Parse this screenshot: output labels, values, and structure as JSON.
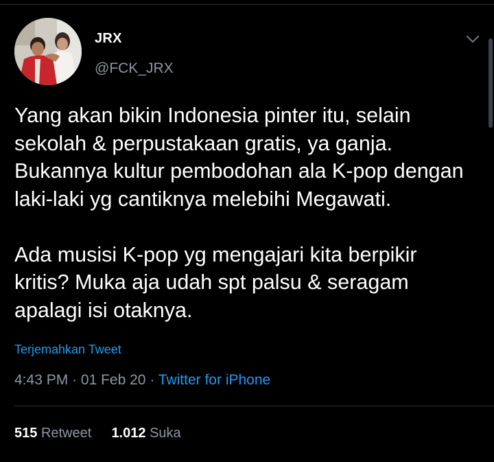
{
  "tweet": {
    "author": {
      "display_name": "JRX",
      "handle": "@FCK_JRX",
      "avatar_icon": "profile-photo"
    },
    "text": "Yang akan bikin Indonesia pinter itu, selain\nsekolah & perpustakaan gratis, ya ganja.\nBukannya kultur pembodohan ala K-pop dengan\nlaki-laki yg cantiknya melebihi Megawati.\n\nAda musisi K-pop yg mengajari kita berpikir\nkritis? Muka aja udah spt palsu & seragam\napalagi isi otaknya.",
    "translate_label": "Terjemahkan Tweet",
    "time": "4:43 PM",
    "separator": "·",
    "date": "01 Feb 20",
    "source": "Twitter for iPhone",
    "stats": {
      "retweets_count": "515",
      "retweets_label": "Retweet",
      "likes_count": "1.012",
      "likes_label": "Suka"
    }
  },
  "colors": {
    "background": "#000000",
    "text_primary": "#ffffff",
    "text_secondary": "#8b98a5",
    "accent": "#1d9bf0",
    "divider": "#2f3336"
  },
  "icons": {
    "more_menu": "chevron-down-icon"
  }
}
